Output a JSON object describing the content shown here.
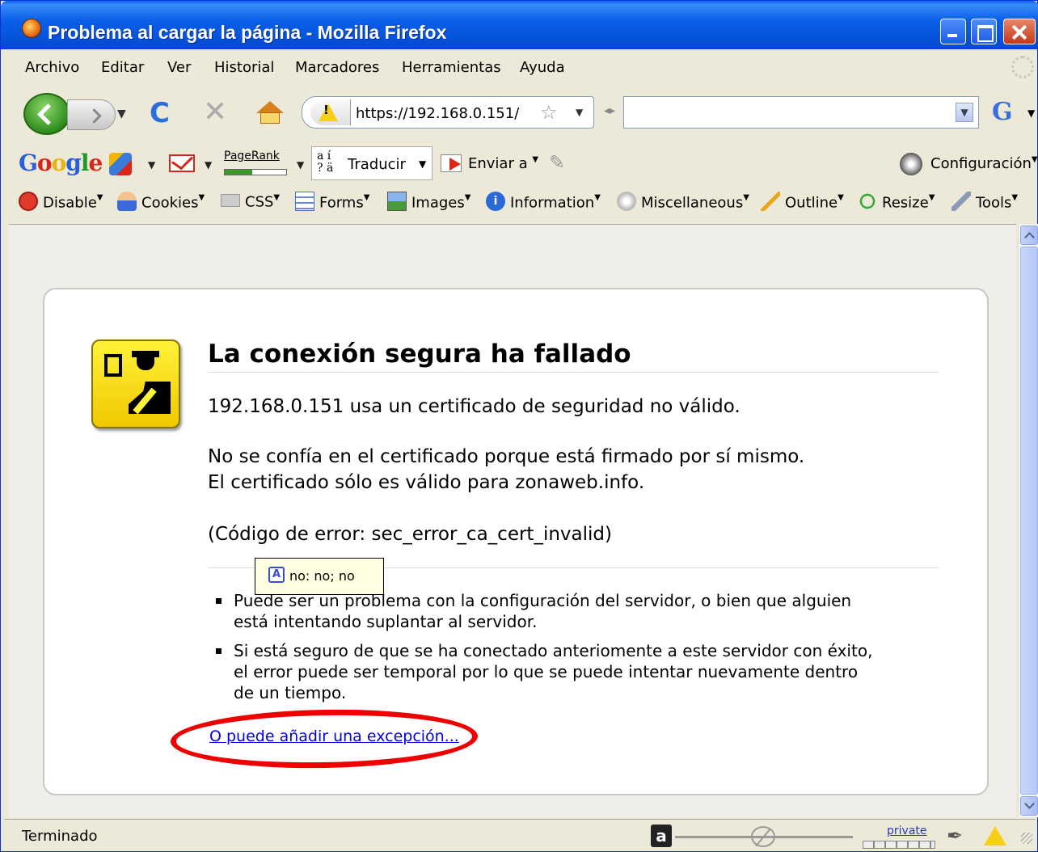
{
  "window": {
    "title": "Problema al cargar la página - Mozilla Firefox"
  },
  "menu": {
    "items": [
      "Archivo",
      "Editar",
      "Ver",
      "Historial",
      "Marcadores",
      "Herramientas",
      "Ayuda"
    ]
  },
  "navbar": {
    "url": "https://192.168.0.151/",
    "search_value": ""
  },
  "google_toolbar": {
    "pagerank_label": "PageRank",
    "translate_label": "Traducir",
    "translate_icon_text": "a í\n? ä",
    "send_label": "Enviar a",
    "config_label": "Configuración"
  },
  "dev_toolbar": {
    "items": [
      "Disable",
      "Cookies",
      "CSS",
      "Forms",
      "Images",
      "Information",
      "Miscellaneous",
      "Outline",
      "Resize",
      "Tools"
    ]
  },
  "error_page": {
    "title": "La conexión segura ha fallado",
    "line1": "192.168.0.151 usa un certificado de seguridad no válido.",
    "line2": "No se confía en el certificado porque está firmado por sí mismo.",
    "line3": "El certificado sólo es válido para zonaweb.info.",
    "line4": "(Código de error: sec_error_ca_cert_invalid)",
    "bullet1": "Puede ser un problema con la configuración del servidor, o bien que alguien\nestá intentando suplantar al servidor.",
    "bullet2": "Si está seguro de que se ha conectado anteriomente a este servidor con éxito,\nel error puede ser temporal por lo que se puede intentar nuevamente dentro\nde un tiempo.",
    "exception_link": "O puede añadir una excepción..."
  },
  "tooltip": {
    "text": "no:  no; no"
  },
  "status": {
    "text": "Terminado",
    "private_label": "private"
  },
  "colors": {
    "titlebar": "#0a5fe9",
    "link": "#0000ee",
    "annotation_ellipse": "#ee0000",
    "warning_icon": "#f5cf1a"
  }
}
